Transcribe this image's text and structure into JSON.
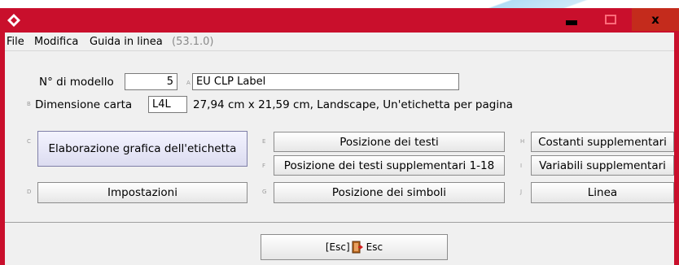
{
  "window": {
    "accent_color": "#c90f2c",
    "close_label": "x"
  },
  "menu": {
    "file": "File",
    "modifica": "Modifica",
    "guida": "Guida in linea",
    "version": "(53.1.0)"
  },
  "form": {
    "model_label": "N° di modello",
    "model_value": "5",
    "hint_a": "A",
    "model_name": "EU CLP Label",
    "hint_b": "B",
    "paper_label": "Dimensione carta",
    "paper_value": "L4L",
    "paper_desc": "27,94 cm x 21,59 cm, Landscape, Un'etichetta per pagina"
  },
  "buttons": {
    "c": {
      "hint": "C",
      "label": "Elaborazione grafica dell'etichetta"
    },
    "d": {
      "hint": "D",
      "label": "Impostazioni"
    },
    "e": {
      "hint": "E",
      "label": "Posizione dei testi"
    },
    "f": {
      "hint": "F",
      "label": "Posizione dei testi supplementari 1-18"
    },
    "g": {
      "hint": "G",
      "label": "Posizione dei simboli"
    },
    "h": {
      "hint": "H",
      "label": "Costanti supplementari"
    },
    "i": {
      "hint": "I",
      "label": "Variabili supplementari"
    },
    "j": {
      "hint": "J",
      "label": "Linea"
    },
    "esc": {
      "prefix": "[Esc]",
      "suffix": "Esc",
      "icon": "exit-door-icon"
    }
  }
}
